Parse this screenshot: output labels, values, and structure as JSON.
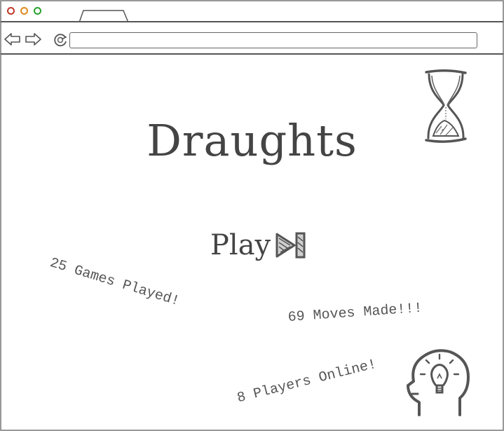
{
  "browser": {
    "address_value": "",
    "icons": {
      "close": "close-dot-icon",
      "minimize": "minimize-dot-icon",
      "maximize": "maximize-dot-icon",
      "back": "arrow-left-icon",
      "forward": "arrow-right-icon",
      "reload": "reload-icon"
    },
    "colors": {
      "close": "#c0392b",
      "minimize": "#e08a1e",
      "maximize": "#27a12d",
      "outline": "#555555"
    }
  },
  "main": {
    "title": "Draughts",
    "play_label": "Play",
    "play_icon": "play-skip-icon",
    "timer_icon": "hourglass-icon",
    "idea_icon": "head-lightbulb-icon",
    "stats": {
      "games": "25 Games Played!",
      "moves": "69 Moves Made!!!",
      "players": "8 Players Online!"
    }
  }
}
